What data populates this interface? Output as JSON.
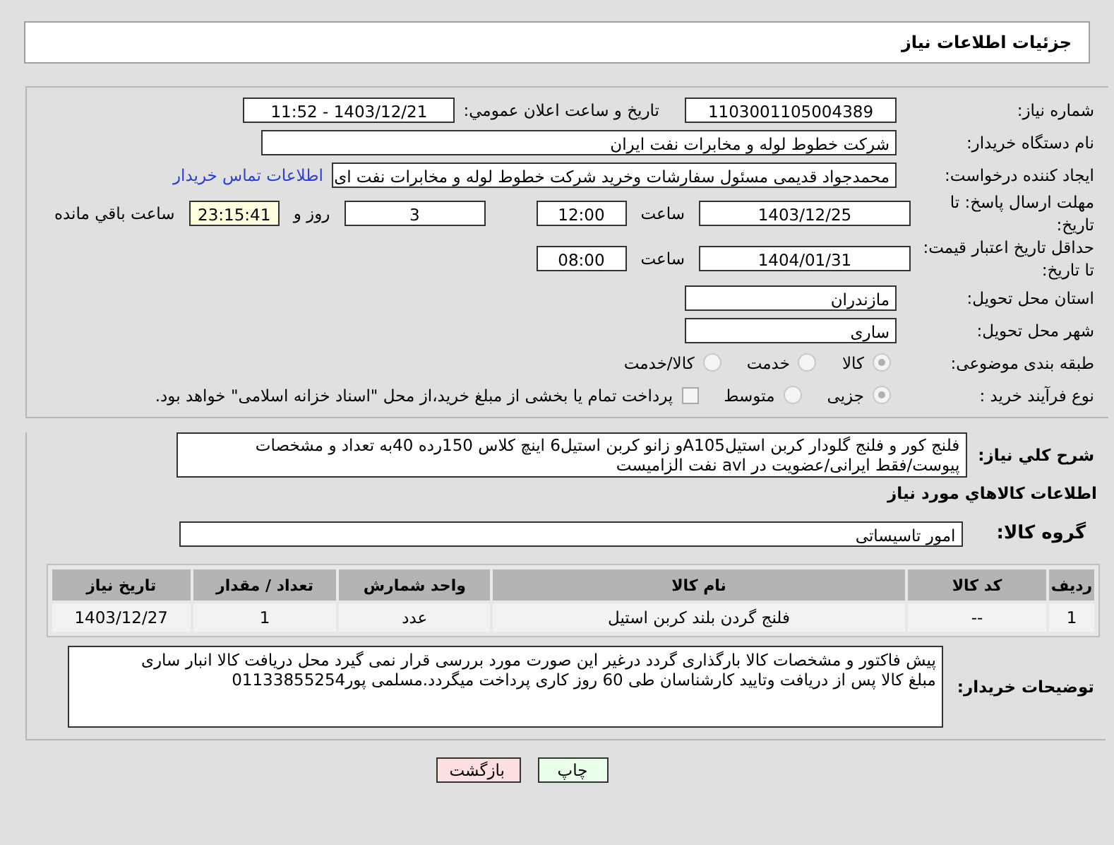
{
  "header": {
    "title": "جزئیات اطلاعات نیاز"
  },
  "need_number": {
    "label": "شماره نیاز:",
    "value": "1103001105004389"
  },
  "announce": {
    "label": "تاریخ و ساعت اعلان عمومي:",
    "value": "1403/12/21 - 11:52"
  },
  "buyer_org": {
    "label": "نام دستگاه خريدار:",
    "value": "شرکت خطوط لوله و مخابرات نفت ایران"
  },
  "creator": {
    "label": "ايجاد کننده درخواست:",
    "value": "محمدجواد قدیمی مسئول سفارشات وخرید شرکت خطوط لوله و مخابرات نفت ای",
    "link": "اطلاعات تماس خريدار"
  },
  "deadline": {
    "label": "مهلت ارسال پاسخ: تا تاریخ:",
    "date": "1403/12/25",
    "time_label": "ساعت",
    "time": "12:00",
    "days": "3",
    "days_label": "روز و",
    "remaining": "23:15:41",
    "remaining_label": "ساعت باقي مانده"
  },
  "validity": {
    "label": "حداقل تاریخ اعتبار قیمت: تا تاریخ:",
    "date": "1404/01/31",
    "time_label": "ساعت",
    "time": "08:00"
  },
  "province": {
    "label": "استان محل تحويل:",
    "value": "مازندران"
  },
  "city": {
    "label": "شهر محل تحويل:",
    "value": "ساری"
  },
  "category": {
    "label": "طبقه بندی موضوعی:",
    "options": [
      {
        "label": "کالا",
        "selected": true
      },
      {
        "label": "خدمت",
        "selected": false
      },
      {
        "label": "کالا/خدمت",
        "selected": false
      }
    ]
  },
  "purchase_type": {
    "label": "نوع فرآیند خرید :",
    "options": [
      {
        "label": "جزیی",
        "selected": true
      },
      {
        "label": "متوسط",
        "selected": false
      }
    ],
    "payment_checkbox": {
      "label": "پرداخت تمام یا بخشی از مبلغ خرید،از محل \"اسناد خزانه اسلامی\" خواهد بود.",
      "checked": false
    }
  },
  "description": {
    "label": "شرح کلي نياز:",
    "lines": [
      "فلنج کور و فلنج گلودار کربن استیلA105و زانو کربن استیل6 اینچ کلاس 150رده 40به تعداد و مشخصات",
      "پیوست/فقط ایرانی/عضویت در avl نفت الزامیست"
    ]
  },
  "goods": {
    "title": "اطلاعات کالاهاي مورد نياز",
    "group_label": "گروه کالا:",
    "group_value": "امور تاسیساتی",
    "columns": [
      "ردیف",
      "کد کالا",
      "نام کالا",
      "واحد شمارش",
      "تعداد / مقدار",
      "تاریخ نیاز"
    ],
    "rows": [
      [
        "1",
        "--",
        "فلنج گردن بلند کربن استیل",
        "عدد",
        "1",
        "1403/12/27"
      ]
    ]
  },
  "buyer_notes": {
    "label": "توضیحات خریدار:",
    "lines": [
      "پیش فاکتور و مشخصات کالا بارگذاری گردد درغیر این صورت مورد بررسی قرار نمی گیرد محل دریافت کالا انبار ساری",
      "مبلغ کالا پس از دریافت وتایید کارشناسان طی 60 روز کاری پرداخت میگردد.مسلمی پور01133855254"
    ]
  },
  "buttons": [
    {
      "label": "چاپ",
      "kind": "print"
    },
    {
      "label": "بازگشت",
      "kind": "back"
    }
  ]
}
